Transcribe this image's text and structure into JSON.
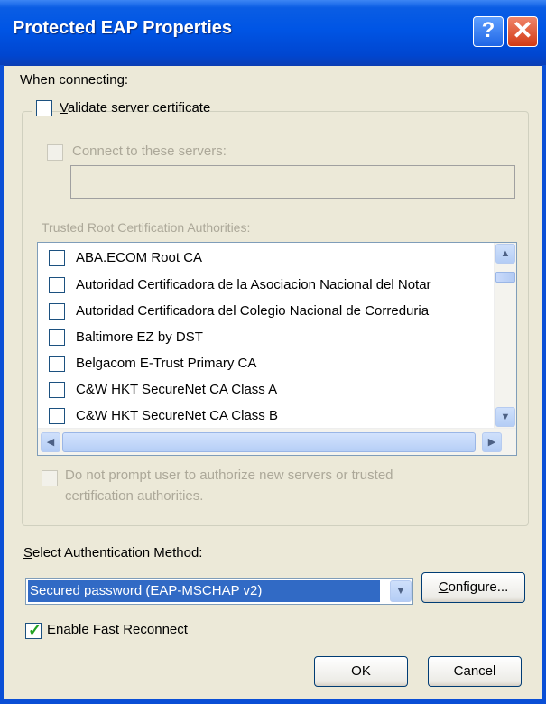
{
  "window": {
    "title": "Protected EAP Properties",
    "help_glyph": "?",
    "close_glyph": "✕"
  },
  "connect_section": {
    "heading": "When connecting:",
    "validate_certificate": {
      "label": "Validate server certificate",
      "checked": false
    },
    "connect_to_servers": {
      "label": "Connect to these servers:",
      "checked": false,
      "enabled": false,
      "value": ""
    },
    "trusted_ca_label": "Trusted Root Certification Authorities:",
    "trusted_cas": [
      {
        "label": "ABA.ECOM Root CA",
        "checked": false
      },
      {
        "label": "Autoridad Certificadora de la Asociacion Nacional del Notar",
        "checked": false
      },
      {
        "label": "Autoridad Certificadora del Colegio Nacional de Correduria",
        "checked": false
      },
      {
        "label": "Baltimore EZ by DST",
        "checked": false
      },
      {
        "label": "Belgacom E-Trust Primary CA",
        "checked": false
      },
      {
        "label": "C&W HKT SecureNet CA Class A",
        "checked": false
      },
      {
        "label": "C&W HKT SecureNet CA Class B",
        "checked": false
      }
    ],
    "do_not_prompt": {
      "line1": "Do not prompt user to authorize new servers or trusted",
      "line2": "certification authorities.",
      "checked": false,
      "enabled": false
    }
  },
  "auth_method": {
    "label": "Select Authentication Method:",
    "selected": "Secured password (EAP-MSCHAP v2)",
    "configure_label": "Configure..."
  },
  "fast_reconnect": {
    "label": "Enable Fast Reconnect",
    "checked": true
  },
  "buttons": {
    "ok": "OK",
    "cancel": "Cancel"
  },
  "colors": {
    "titlebar": "#0055e5",
    "selection": "#316ac5",
    "dialog_bg": "#ece9d8",
    "disabled_text": "#aca899"
  }
}
